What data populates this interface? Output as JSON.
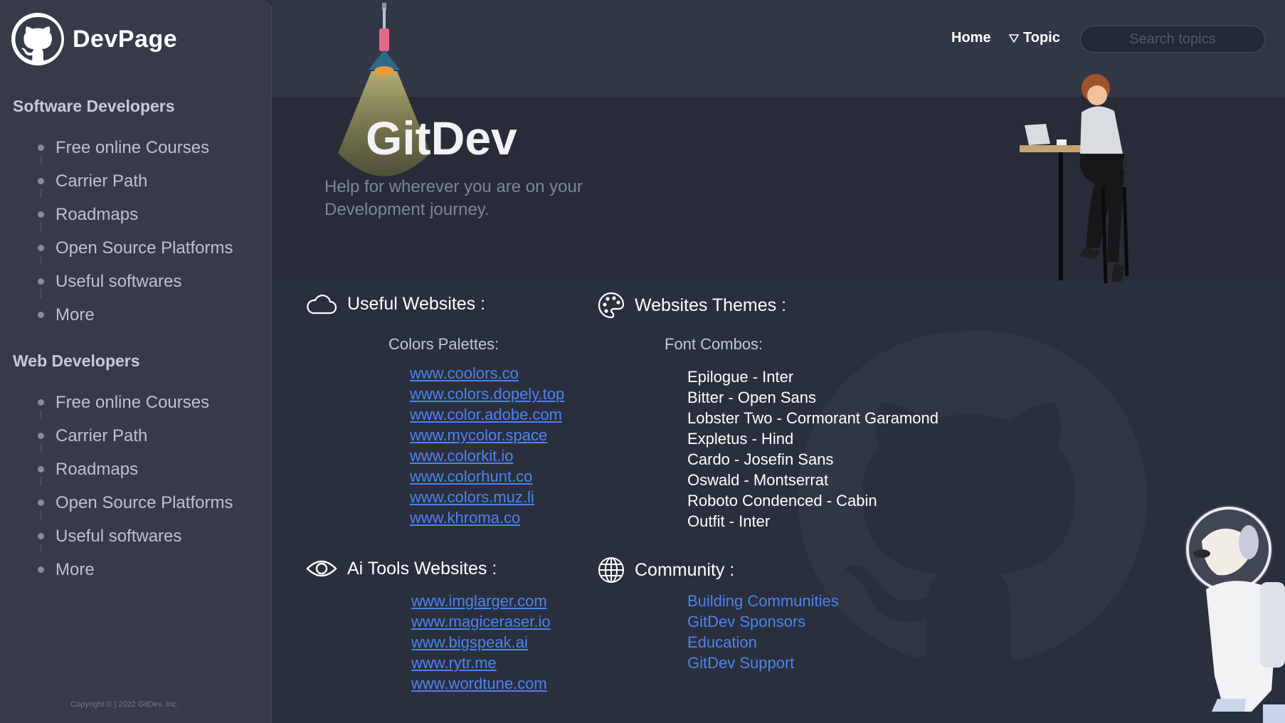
{
  "brand": {
    "name": "DevPage"
  },
  "sidebar": {
    "sections": [
      {
        "title": "Software Developers",
        "items": [
          "Free online Courses",
          "Carrier Path",
          "Roadmaps",
          "Open Source Platforms",
          "Useful softwares",
          "More"
        ]
      },
      {
        "title": "Web Developers",
        "items": [
          "Free online Courses",
          "Carrier Path",
          "Roadmaps",
          "Open Source Platforms",
          "Useful softwares",
          "More"
        ]
      }
    ],
    "copyright": "Copyright ©  |   2022 GitDev, Inc."
  },
  "nav": {
    "home": "Home",
    "topic": "Topic",
    "search_placeholder": "Search topics"
  },
  "hero": {
    "title": "GitDev",
    "subtitle": "Help for wherever you are on your Development journey."
  },
  "useful_websites": {
    "title": "Useful Websites :",
    "subtitle": "Colors Palettes:",
    "links": [
      "www.coolors.co",
      "www.colors.dopely.top",
      "www.color.adobe.com",
      "www.mycolor.space",
      "www.colorkit.io",
      "www.colorhunt.co",
      "www.colors.muz.li",
      "www.khroma.co"
    ]
  },
  "website_themes": {
    "title": "Websites Themes :",
    "subtitle": "Font Combos:",
    "items": [
      "Epilogue - Inter",
      "Bitter - Open Sans",
      "Lobster Two - Cormorant Garamond",
      "Expletus - Hind",
      "Cardo - Josefin Sans",
      "Oswald - Montserrat",
      "Roboto Condenced - Cabin",
      "Outfit - Inter"
    ]
  },
  "ai_tools": {
    "title": "Ai Tools Websites :",
    "links": [
      "www.imglarger.com",
      "www.magiceraser.io",
      "www.bigspeak.ai",
      "www.rytr.me",
      "www.wordtune.com"
    ]
  },
  "community": {
    "title": "Community :",
    "links": [
      "Building Communities",
      "GitDev Sponsors",
      "Education",
      "GitDev Support"
    ]
  },
  "colors": {
    "background": "#2a2f3d",
    "sidebar": "#373b48",
    "hero": "#272c38",
    "link": "#4c84f2"
  }
}
